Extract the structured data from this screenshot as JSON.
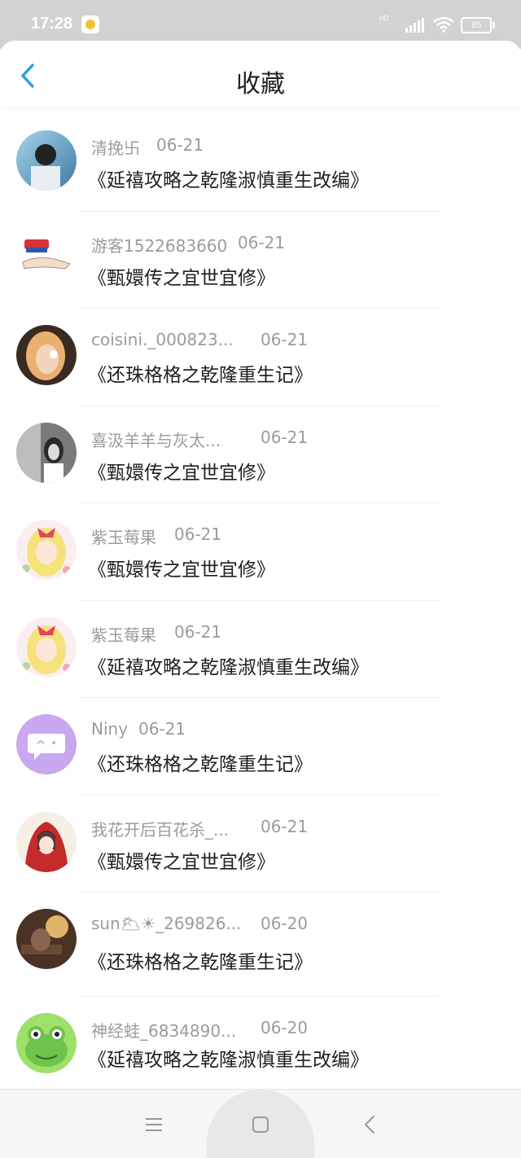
{
  "status_bar": {
    "time": "17:28",
    "network": "HD",
    "battery": "85",
    "icons": [
      "app-notification-icon",
      "signal-icon",
      "wifi-icon",
      "battery-icon"
    ]
  },
  "header": {
    "title": "收藏",
    "back_icon": "chevron-left-icon",
    "accent_color": "#2d9be6"
  },
  "items": [
    {
      "user": "清挽卐",
      "date": "06-21",
      "title": "《延禧攻略之乾隆淑慎重生改编》"
    },
    {
      "user": "游客1522683660",
      "date": "06-21",
      "title": "《甄嬛传之宜世宜修》"
    },
    {
      "user": "coisini._000823...",
      "date": "06-21",
      "title": "《还珠格格之乾隆重生记》"
    },
    {
      "user": "喜汲羊羊与灰太...",
      "date": "06-21",
      "title": "《甄嬛传之宜世宜修》"
    },
    {
      "user": "紫玉莓果",
      "date": "06-21",
      "title": "《甄嬛传之宜世宜修》"
    },
    {
      "user": "紫玉莓果",
      "date": "06-21",
      "title": "《延禧攻略之乾隆淑慎重生改编》"
    },
    {
      "user": "Niny",
      "date": "06-21",
      "title": "《还珠格格之乾隆重生记》"
    },
    {
      "user": "我花开后百花杀_...",
      "date": "06-21",
      "title": "《甄嬛传之宜世宜修》"
    },
    {
      "user": "sun🌥☀_269826...",
      "date": "06-20",
      "title": "《还珠格格之乾隆重生记》"
    },
    {
      "user": "神经蛙_6834890...",
      "date": "06-20",
      "title": "《延禧攻略之乾隆淑慎重生改编》"
    }
  ],
  "nav": {
    "icons": [
      "menu-icon",
      "home-square-icon",
      "back-triangle-icon"
    ]
  }
}
